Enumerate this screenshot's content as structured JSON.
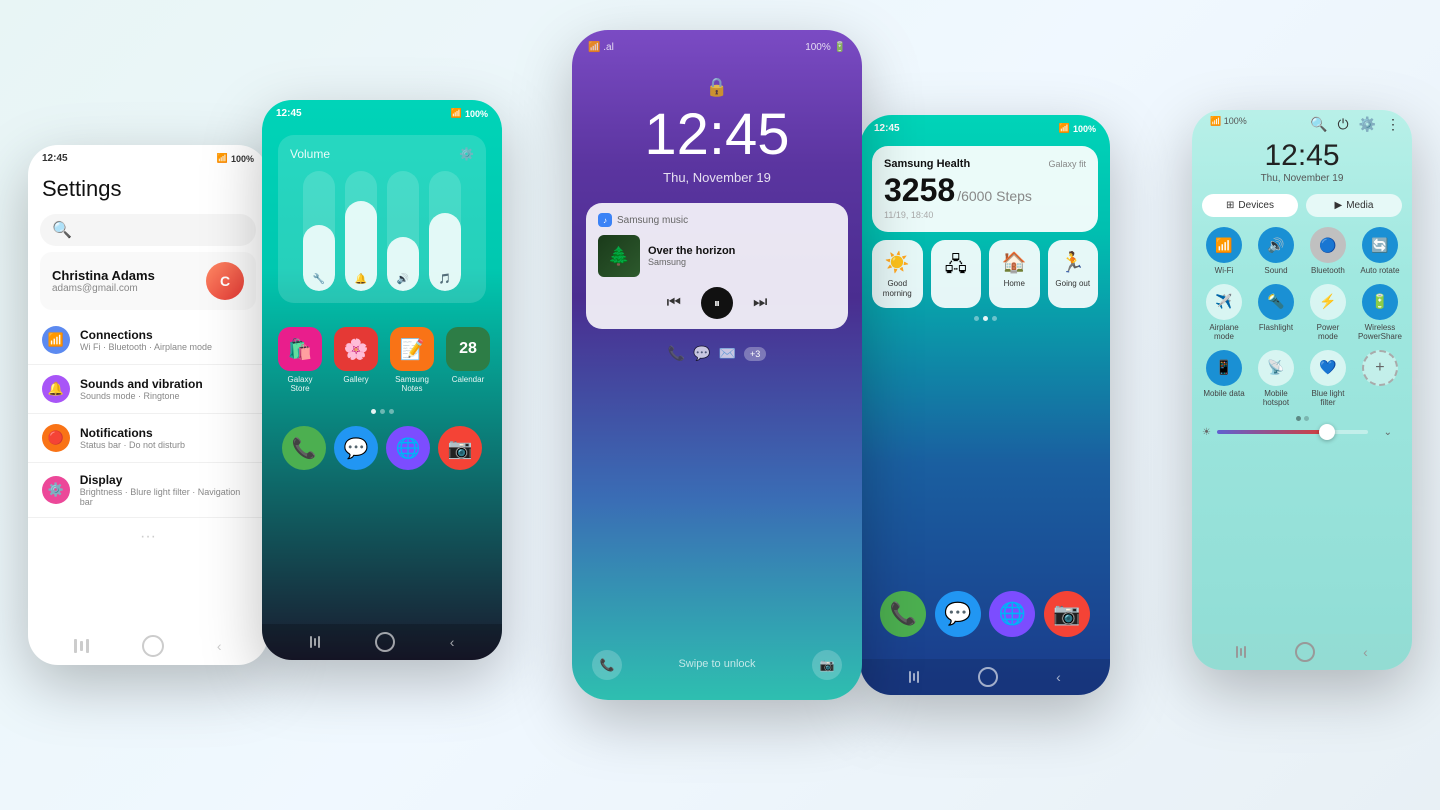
{
  "background": "#e8f4f2",
  "phone1": {
    "status_time": "12:45",
    "status_signal": "📶",
    "status_battery": "100%",
    "title": "Settings",
    "profile_name": "Christina Adams",
    "profile_email": "adams@gmail.com",
    "menu_items": [
      {
        "label": "Connections",
        "sub": "Wi Fi · Bluetooth · Airplane mode",
        "color": "#5c8af0",
        "icon": "📶"
      },
      {
        "label": "Sounds and vibration",
        "sub": "Sounds mode · Ringtone",
        "color": "#a855f7",
        "icon": "🔔"
      },
      {
        "label": "Notifications",
        "sub": "Status bar · Do not disturb",
        "color": "#f97316",
        "icon": "🔴"
      },
      {
        "label": "Display",
        "sub": "Brightness · Blure light filter · Navigation bar",
        "color": "#ec4899",
        "icon": "⚙️"
      }
    ]
  },
  "phone2": {
    "status_time": "12:45",
    "volume_title": "Volume",
    "sliders": [
      {
        "icon": "🔧",
        "fill": 55
      },
      {
        "icon": "🔔",
        "fill": 75
      },
      {
        "icon": "🔊",
        "fill": 45
      },
      {
        "icon": "🎵",
        "fill": 65
      }
    ],
    "apps": [
      {
        "label": "Galaxy Store",
        "bg": "#e91e8c",
        "emoji": "🛍️"
      },
      {
        "label": "Gallery",
        "bg": "#e53935",
        "emoji": "🌸"
      },
      {
        "label": "Samsung Notes",
        "bg": "#f97316",
        "emoji": "📝"
      },
      {
        "label": "Calendar",
        "bg": "#2d7d46",
        "emoji": "28"
      }
    ],
    "bottom_apps": [
      {
        "emoji": "📞",
        "bg": "#4caf50"
      },
      {
        "emoji": "💬",
        "bg": "#2196f3"
      },
      {
        "emoji": "🌐",
        "bg": "#7c4dff"
      },
      {
        "emoji": "📷",
        "bg": "#f44336"
      }
    ]
  },
  "phone3": {
    "time": "12:45",
    "date": "Thu, November 19",
    "music_app": "Samsung music",
    "track": "Over the horizon",
    "artist": "Samsung",
    "notification_count": "+3",
    "swipe_text": "Swipe to unlock"
  },
  "phone4": {
    "status_time": "12:45",
    "health_title": "Samsung Health",
    "health_sub": "Galaxy fit",
    "steps": "3258",
    "steps_goal": "/6000 Steps",
    "health_date": "11/19, 18:40",
    "quick_items": [
      {
        "label": "Good morning",
        "icon": "☀️"
      },
      {
        "label": "",
        "icon": "🏠"
      },
      {
        "label": "Home",
        "icon": "🏠"
      },
      {
        "label": "Going out",
        "icon": "🏃"
      }
    ],
    "bottom_apps": [
      {
        "emoji": "📞",
        "bg": "#4caf50"
      },
      {
        "emoji": "💬",
        "bg": "#2196f3"
      },
      {
        "emoji": "🌐",
        "bg": "#7c4dff"
      },
      {
        "emoji": "📷",
        "bg": "#f44336"
      }
    ]
  },
  "phone5": {
    "time": "12:45",
    "date": "Thu, November 19",
    "tabs": [
      {
        "label": "Devices",
        "icon": "⊞"
      },
      {
        "label": "Media",
        "icon": "▶"
      }
    ],
    "toggles": [
      {
        "label": "Wi-Fi",
        "icon": "📶",
        "active": true
      },
      {
        "label": "Sound",
        "icon": "🔊",
        "active": true
      },
      {
        "label": "Bluetooth",
        "icon": "🔵",
        "active": false,
        "gray": true
      },
      {
        "label": "Auto rotate",
        "icon": "🔄",
        "active": true
      },
      {
        "label": "Airplane mode",
        "icon": "✈️",
        "active": false
      },
      {
        "label": "Flashlight",
        "icon": "🔦",
        "active": true
      },
      {
        "label": "Power mode",
        "icon": "⚡",
        "active": false
      },
      {
        "label": "Wireless PowerShare",
        "icon": "🔋",
        "active": true
      },
      {
        "label": "Mobile data",
        "icon": "📱",
        "active": true
      },
      {
        "label": "Mobile hotspot",
        "icon": "📡",
        "active": false
      },
      {
        "label": "Blue light filter",
        "icon": "💙",
        "active": false
      }
    ],
    "brightness": 70
  }
}
